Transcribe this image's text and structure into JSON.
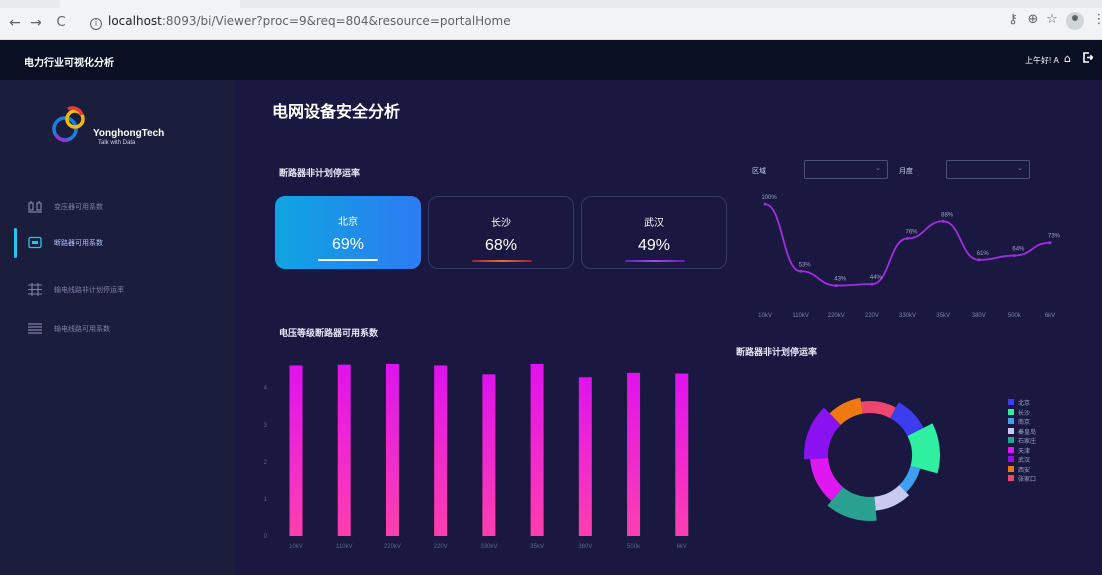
{
  "browser": {
    "url_host": "localhost",
    "url_rest": ":8093/bi/Viewer?proc=9&req=804&resource=portalHome",
    "back": "←",
    "forward": "→",
    "reload": "C",
    "icons": [
      "key-icon",
      "zoom-icon",
      "star-icon",
      "profile-icon",
      "menu-icon"
    ]
  },
  "app": {
    "title": "电力行业可视化分析",
    "greeting": "上午好! A",
    "icons": [
      "home-icon",
      "logout-icon"
    ]
  },
  "logo": {
    "brand": "YonghongTech",
    "tagline": "Talk with Data",
    "colors": [
      "#e03c3c",
      "#f6b800",
      "#1c7fe0",
      "#8a3ad0"
    ]
  },
  "sidebar": {
    "items": [
      {
        "label": "变压器可用系数",
        "icon": "transformer-icon",
        "active": false
      },
      {
        "label": "断路器可用系数",
        "icon": "breaker-icon",
        "active": true
      },
      {
        "label": "输电线路非计划停运率",
        "icon": "transmission-line-icon",
        "active": false
      },
      {
        "label": "输电线路可用系数",
        "icon": "line-availability-icon",
        "active": false
      }
    ],
    "accent": "#27c4f0"
  },
  "main": {
    "title": "电网设备安全分析",
    "kpi_section_title": "断路器非计划停运率",
    "kpis": [
      {
        "city": "北京",
        "value": "69%",
        "active": true,
        "underline": "#ffffff"
      },
      {
        "city": "长沙",
        "value": "68%",
        "active": false,
        "underline": "#e86a2a"
      },
      {
        "city": "武汉",
        "value": "49%",
        "active": false,
        "underline": "#a23ce0"
      }
    ],
    "filters": [
      {
        "label": "区域",
        "value": ""
      },
      {
        "label": "月度",
        "value": ""
      }
    ],
    "bar_section_title": "电压等级断路器可用系数",
    "donut_section_title": "断路器非计划停运率"
  },
  "chart_data": [
    {
      "type": "line",
      "title": "",
      "categories": [
        "10kV",
        "110kV",
        "220kV",
        "220V",
        "330kV",
        "35kV",
        "380V",
        "500k",
        "6kV"
      ],
      "series": [
        {
          "values": [
            100,
            53,
            43,
            44,
            76,
            88,
            61,
            64,
            73
          ]
        }
      ],
      "data_labels": [
        "100%",
        "53%",
        "43%",
        "44%",
        "76%",
        "88%",
        "61%",
        "64%",
        "73%"
      ],
      "color": "#a02de0",
      "ylim": [
        35,
        105
      ],
      "grid": false
    },
    {
      "type": "bar",
      "title": "",
      "categories": [
        "10kV",
        "110kV",
        "220kV",
        "220V",
        "330kV",
        "35kV",
        "380V",
        "500k",
        "6kV"
      ],
      "values": [
        4.6,
        4.62,
        4.64,
        4.6,
        4.36,
        4.64,
        4.28,
        4.4,
        4.38
      ],
      "yticks": [
        "0",
        "1",
        "2",
        "3",
        "4"
      ],
      "ylim": [
        0,
        4.8
      ],
      "color_top": "#e012f0",
      "color_bottom": "#ff3fae",
      "grid": false
    },
    {
      "type": "pie",
      "title": "",
      "labels": [
        "北京",
        "长沙",
        "南京",
        "秦皇岛",
        "石家庄",
        "天津",
        "武汉",
        "西安",
        "张家口"
      ],
      "values": [
        9,
        11,
        8,
        10,
        12,
        12,
        13,
        9,
        10
      ],
      "radii": [
        60,
        70,
        52,
        56,
        66,
        60,
        66,
        58,
        54
      ],
      "colors": [
        "#3d3df0",
        "#2ef0a0",
        "#3ea0f0",
        "#c7cbf2",
        "#2aa090",
        "#e018f0",
        "#8a12f0",
        "#f07a12",
        "#f0466e"
      ],
      "legend": "right"
    }
  ]
}
